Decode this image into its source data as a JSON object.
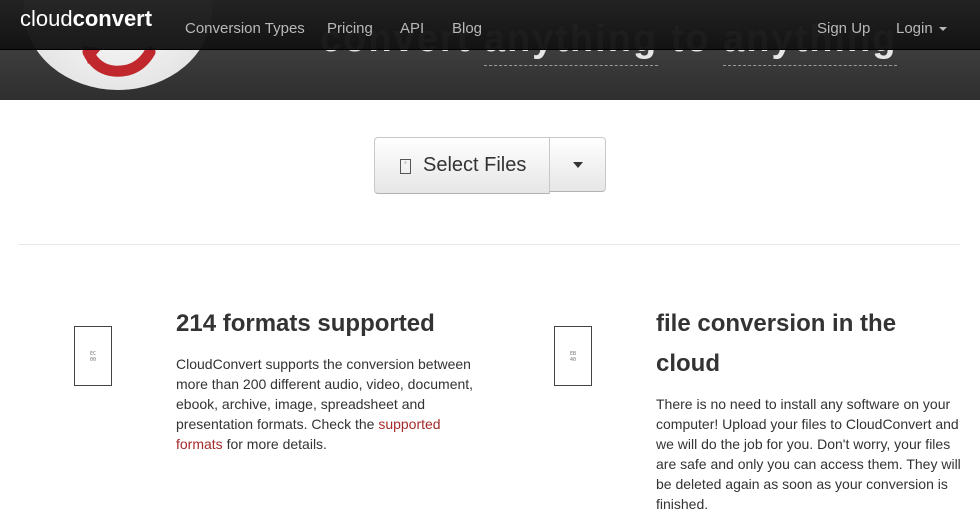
{
  "brand": {
    "light": "cloud",
    "bold": "convert"
  },
  "nav": {
    "items": [
      "Conversion Types",
      "Pricing",
      "API",
      "Blog"
    ],
    "sign_up": "Sign Up",
    "login": "Login"
  },
  "hero": {
    "text_parts": [
      "convert ",
      "anything",
      " to ",
      "anything"
    ]
  },
  "select_files": {
    "label": "Select Files",
    "icon": "file-icon",
    "dropdown_icon": "caret-down-icon"
  },
  "features": [
    {
      "icon": "formats-icon",
      "icon_glyph": "EC\n00",
      "title": "214 formats supported",
      "text_before": "CloudConvert supports the conversion between more than 200 different audio, video, document, ebook, archive, image, spreadsheet and presentation formats. Check the ",
      "link": "supported formats",
      "text_after": " for more details."
    },
    {
      "icon": "cloud-icon",
      "icon_glyph": "EB\n40",
      "title": "file conversion in the cloud",
      "text": "There is no need to install any software on your computer! Upload your files to CloudConvert and we will do the job for you. Don't worry, your files are safe and only you can access them. They will be deleted again as soon as your conversion is finished."
    }
  ],
  "colors": {
    "navbar": "#1b1b1b",
    "link": "#a52a2a",
    "logo_arrow": "#c0282d"
  }
}
